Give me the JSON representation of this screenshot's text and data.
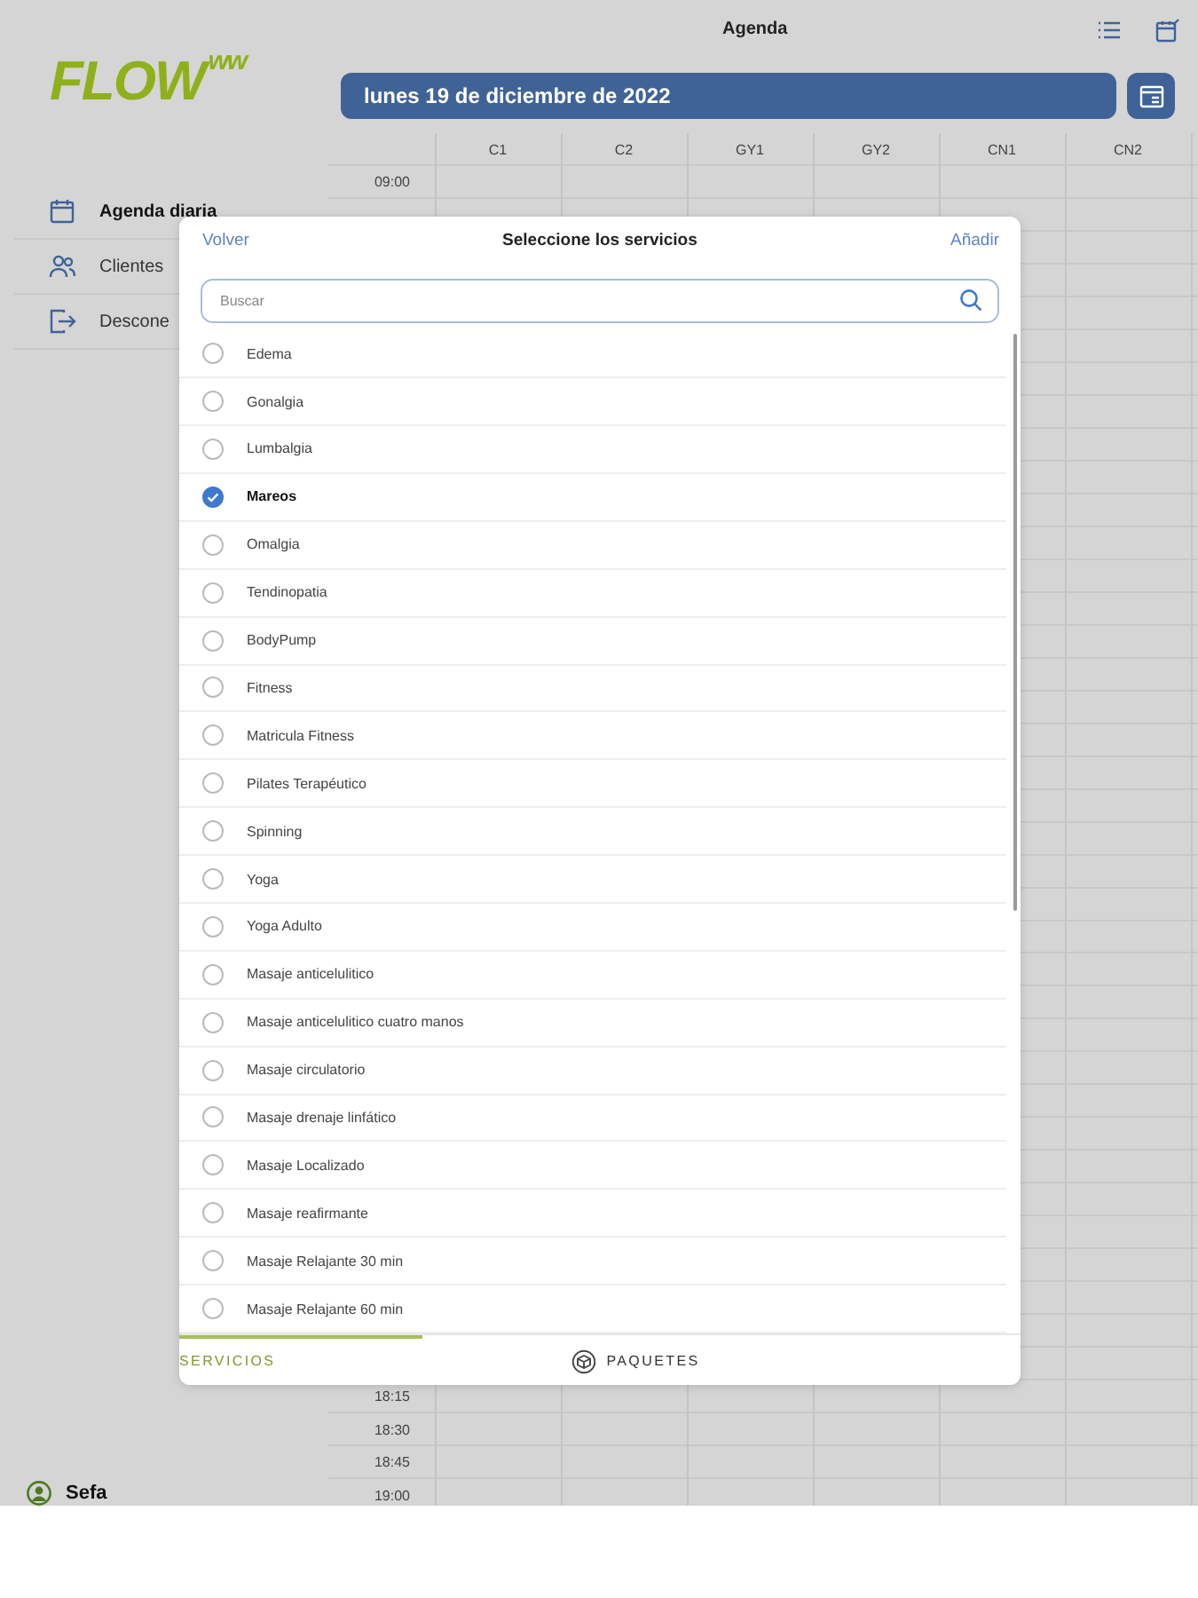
{
  "header": {
    "title": "Agenda"
  },
  "logo": {
    "main": "FLOW",
    "mark": "ww"
  },
  "date_bar": {
    "label": "lunes 19 de diciembre de 2022"
  },
  "sidebar": {
    "items": [
      {
        "label": "Agenda diaria",
        "selected": true,
        "kind": "calendar"
      },
      {
        "label": "Clientes",
        "selected": false,
        "kind": "people"
      },
      {
        "label": "Descone",
        "selected": false,
        "kind": "logout"
      }
    ],
    "user": "Sefa"
  },
  "agenda": {
    "columns": [
      "C1",
      "C2",
      "GY1",
      "GY2",
      "CN1",
      "CN2"
    ],
    "times_top": [
      "09:00"
    ],
    "times_bottom": [
      "18:15",
      "18:30",
      "18:45",
      "19:00"
    ]
  },
  "dialog": {
    "back": "Volver",
    "title": "Seleccione los servicios",
    "add": "Añadir",
    "search": {
      "placeholder": "Buscar"
    },
    "services": [
      {
        "label": "Edema",
        "checked": false
      },
      {
        "label": "Gonalgia",
        "checked": false
      },
      {
        "label": "Lumbalgia",
        "checked": false
      },
      {
        "label": "Mareos",
        "checked": true
      },
      {
        "label": "Omalgia",
        "checked": false
      },
      {
        "label": "Tendinopatia",
        "checked": false
      },
      {
        "label": "BodyPump",
        "checked": false
      },
      {
        "label": "Fitness",
        "checked": false
      },
      {
        "label": "Matricula Fitness",
        "checked": false
      },
      {
        "label": "Pilates Terapéutico",
        "checked": false
      },
      {
        "label": "Spinning",
        "checked": false
      },
      {
        "label": "Yoga",
        "checked": false
      },
      {
        "label": "Yoga Adulto",
        "checked": false
      },
      {
        "label": "Masaje anticelulitico",
        "checked": false
      },
      {
        "label": "Masaje anticelulitico cuatro manos",
        "checked": false
      },
      {
        "label": "Masaje circulatorio",
        "checked": false
      },
      {
        "label": "Masaje drenaje linfático",
        "checked": false
      },
      {
        "label": "Masaje Localizado",
        "checked": false
      },
      {
        "label": "Masaje reafirmante",
        "checked": false
      },
      {
        "label": "Masaje Relajante 30 min",
        "checked": false
      },
      {
        "label": "Masaje Relajante 60 min",
        "checked": false
      }
    ],
    "tabs": [
      {
        "label": "SERVICIOS",
        "selected": true,
        "kind": "plain"
      },
      {
        "label": "PAQUETES",
        "selected": false,
        "kind": "box"
      }
    ]
  }
}
